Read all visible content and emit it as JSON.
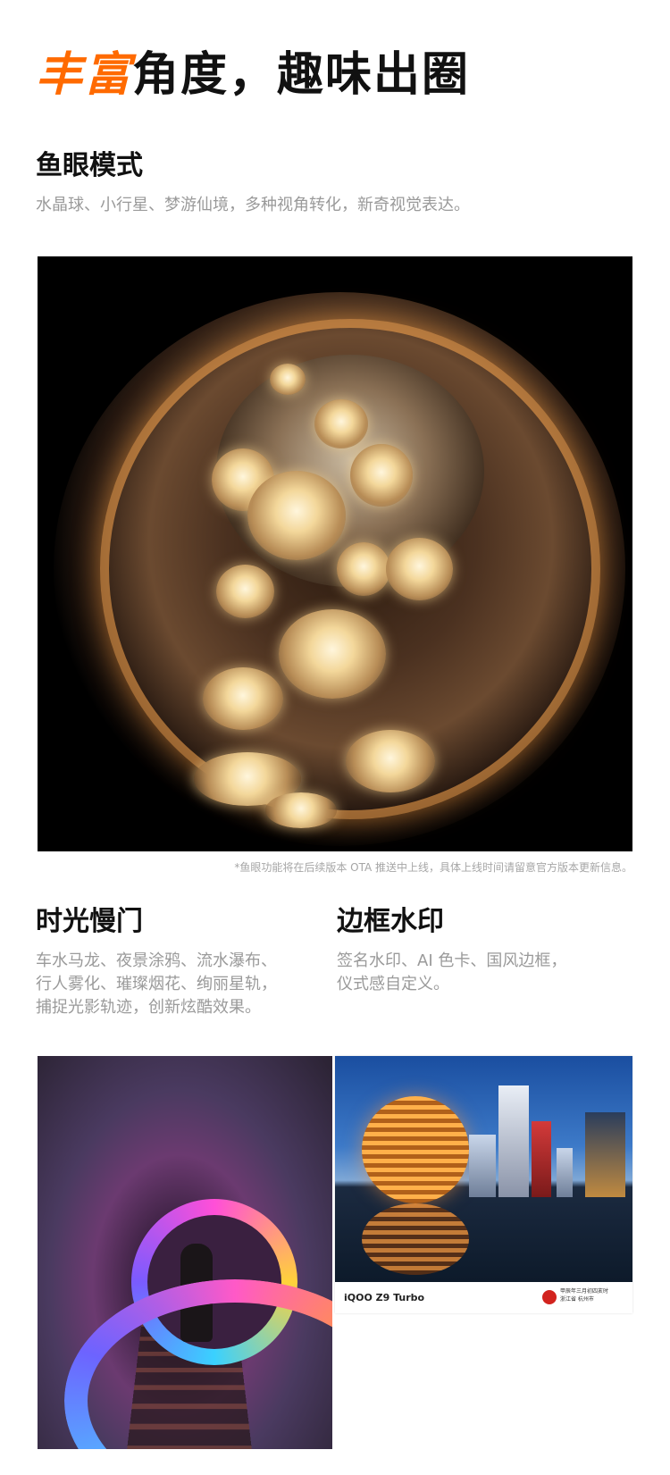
{
  "headline": {
    "accent": "丰富",
    "rest": "角度，趣味出圈"
  },
  "fisheye": {
    "title": "鱼眼模式",
    "desc": "水晶球、小行星、梦游仙境，多种视角转化，新奇视觉表达。",
    "footnote": "*鱼眼功能将在后续版本 OTA 推送中上线，具体上线时间请留意官方版本更新信息。"
  },
  "long_exposure": {
    "title": "时光慢门",
    "desc_lines": [
      "车水马龙、夜景涂鸦、流水瀑布、",
      "行人雾化、璀璨烟花、绚丽星轨，",
      "捕捉光影轨迹，创新炫酷效果。"
    ]
  },
  "watermark": {
    "title": "边框水印",
    "desc_lines": [
      "签名水印、AI 色卡、国风边框，",
      "仪式感自定义。"
    ],
    "brand": "iQOO Z9 Turbo",
    "seal_lines": [
      "甲辰年三月初四亥时",
      "浙江省 杭州市"
    ]
  },
  "colors": {
    "accent": "#ff6a00",
    "title": "#111111",
    "desc": "#9a9a9a"
  }
}
